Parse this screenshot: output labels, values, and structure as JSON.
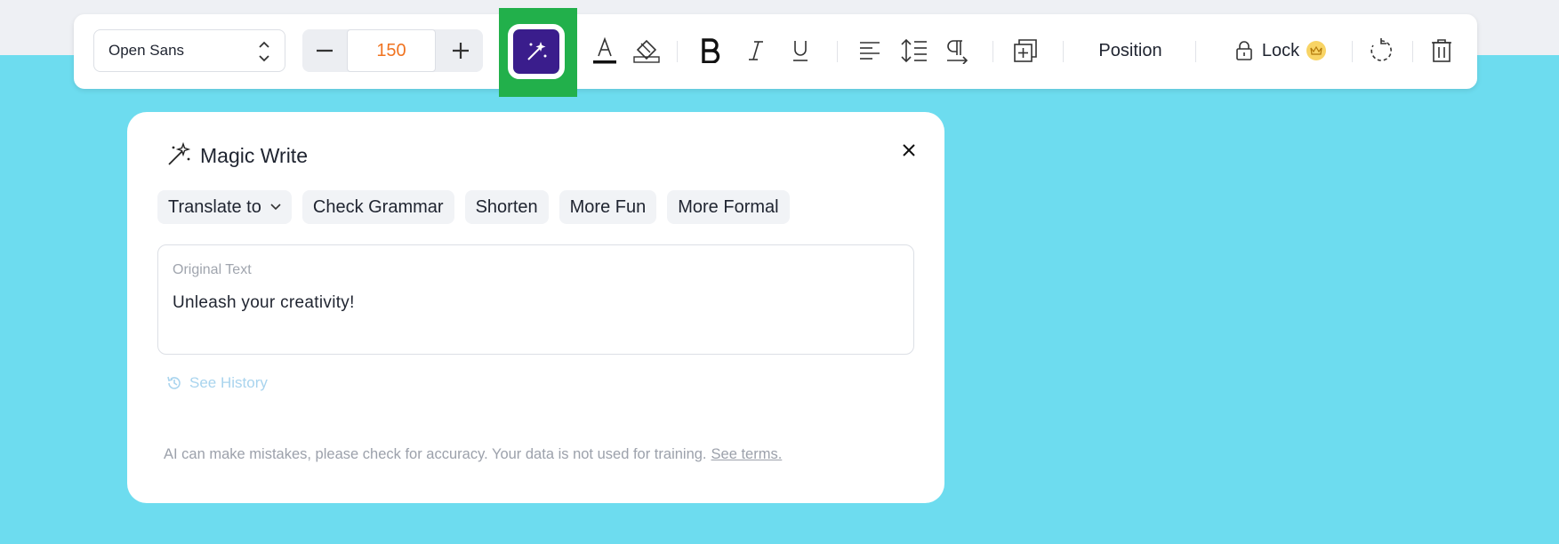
{
  "toolbar": {
    "font_name": "Open Sans",
    "font_size": "150",
    "position_label": "Position",
    "lock_label": "Lock",
    "magic_button_color": "#3a1d8c",
    "highlight_color": "#22b04b",
    "font_size_color": "#f07320",
    "icons": [
      "minus-icon",
      "plus-icon",
      "magic-wand-icon",
      "text-color-icon",
      "fill-color-icon",
      "bold-icon",
      "italic-icon",
      "underline-icon",
      "align-left-icon",
      "line-spacing-icon",
      "paragraph-icon",
      "duplicate-icon",
      "lock-icon",
      "crown-icon",
      "rotate-icon",
      "trash-icon"
    ]
  },
  "panel": {
    "title": "Magic Write",
    "chips": {
      "translate": "Translate to",
      "grammar": "Check Grammar",
      "shorten": "Shorten",
      "fun": "More Fun",
      "formal": "More Formal"
    },
    "original_label": "Original Text",
    "original_value": "Unleash your creativity!",
    "history_label": "See History",
    "disclaimer": "AI can make mistakes, please check for accuracy. Your data is not used for training.",
    "terms_link": "See terms."
  },
  "canvas_color": "#6ddcef"
}
